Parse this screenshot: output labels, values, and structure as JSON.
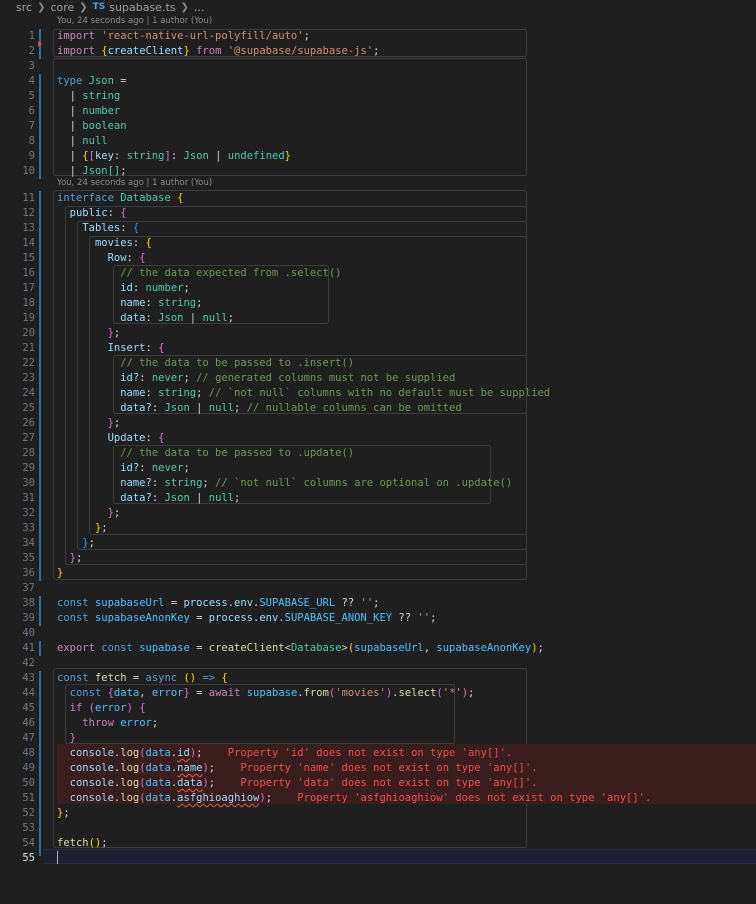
{
  "breadcrumb": {
    "items": [
      "src",
      "core"
    ],
    "file_icon": "TS",
    "file": "supabase.ts",
    "ellipsis": "..."
  },
  "codelens": {
    "top": "You, 24 seconds ago | 1 author (You)",
    "interface": "You, 24 seconds ago | 1 author (You)"
  },
  "line_numbers": [
    "1",
    "2",
    "3",
    "4",
    "5",
    "6",
    "7",
    "8",
    "9",
    "10",
    "11",
    "12",
    "13",
    "14",
    "15",
    "16",
    "17",
    "18",
    "19",
    "20",
    "21",
    "22",
    "23",
    "24",
    "25",
    "26",
    "27",
    "28",
    "29",
    "30",
    "31",
    "32",
    "33",
    "34",
    "35",
    "36",
    "37",
    "38",
    "39",
    "40",
    "41",
    "42",
    "43",
    "44",
    "45",
    "46",
    "47",
    "48",
    "49",
    "50",
    "51",
    "52",
    "53",
    "54",
    "55"
  ],
  "code": {
    "l1": {
      "kw": "import",
      "str": "'react-native-url-polyfill/auto'",
      "end": ";"
    },
    "l2": {
      "kw": "import",
      "name": "createClient",
      "from": "from",
      "str": "'@supabase/supabase-js'",
      "end": ";"
    },
    "l4": {
      "kw": "type",
      "name": "Json",
      "eq": " ="
    },
    "l5": {
      "t": "string"
    },
    "l6": {
      "t": "number"
    },
    "l7": {
      "t": "boolean"
    },
    "l8": {
      "t": "null"
    },
    "l9": {
      "key": "key",
      "t1": "string",
      "t2": "Json",
      "t3": "undefined"
    },
    "l10": {
      "t": "Json[]"
    },
    "l11": {
      "kw": "interface",
      "name": "Database"
    },
    "l12": {
      "name": "public"
    },
    "l13": {
      "name": "Tables"
    },
    "l14": {
      "name": "movies"
    },
    "l15": {
      "name": "Row"
    },
    "l16": {
      "comment": "// the data expected from .select()"
    },
    "l17": {
      "prop": "id",
      "t": "number"
    },
    "l18": {
      "prop": "name",
      "t": "string"
    },
    "l19": {
      "prop": "data",
      "t1": "Json",
      "t2": "null"
    },
    "l21": {
      "name": "Insert"
    },
    "l22": {
      "comment": "// the data to be passed to .insert()"
    },
    "l23": {
      "prop": "id?",
      "t": "never",
      "comment": "// generated columns must not be supplied"
    },
    "l24": {
      "prop": "name",
      "t": "string",
      "comment": "// `not null` columns with no default must be supplied"
    },
    "l25": {
      "prop": "data?",
      "t1": "Json",
      "t2": "null",
      "comment": "// nullable columns can be omitted"
    },
    "l27": {
      "name": "Update"
    },
    "l28": {
      "comment": "// the data to be passed to .update()"
    },
    "l29": {
      "prop": "id?",
      "t": "never"
    },
    "l30": {
      "prop": "name?",
      "t": "string",
      "comment": "// `not null` columns are optional on .update()"
    },
    "l31": {
      "prop": "data?",
      "t1": "Json",
      "t2": "null"
    },
    "l38": {
      "kw": "const",
      "name": "supabaseUrl",
      "obj": "process",
      "env": "env",
      "cst": "SUPABASE_URL",
      "op": "??",
      "str": "''"
    },
    "l39": {
      "kw": "const",
      "name": "supabaseAnonKey",
      "obj": "process",
      "env": "env",
      "cst": "SUPABASE_ANON_KEY",
      "op": "??",
      "str": "''"
    },
    "l41": {
      "kw1": "export",
      "kw2": "const",
      "name": "supabase",
      "fn": "createClient",
      "type": "Database",
      "a1": "supabaseUrl",
      "a2": "supabaseAnonKey"
    },
    "l43": {
      "kw": "const",
      "name": "fetch",
      "kw2": "async"
    },
    "l44": {
      "kw": "const",
      "d": "data",
      "e": "error",
      "kw2": "await",
      "obj": "supabase",
      "fn1": "from",
      "str1": "'movies'",
      "fn2": "select",
      "str2": "'*'"
    },
    "l45": {
      "kw": "if",
      "e": "error"
    },
    "l46": {
      "kw": "throw",
      "e": "error"
    },
    "l48": {
      "obj": "console",
      "fn": "log",
      "d": "data",
      "prop": "id",
      "msg": "Property 'id' does not exist on type 'any[]'."
    },
    "l49": {
      "obj": "console",
      "fn": "log",
      "d": "data",
      "prop": "name",
      "msg": "Property 'name' does not exist on type 'any[]'."
    },
    "l50": {
      "obj": "console",
      "fn": "log",
      "d": "data",
      "prop": "data",
      "msg": "Property 'data' does not exist on type 'any[]'."
    },
    "l51": {
      "obj": "console",
      "fn": "log",
      "d": "data",
      "prop": "asfghioaghiow",
      "msg": "Property 'asfghioaghiow' does not exist on type 'any[]'."
    },
    "l54": {
      "fn": "fetch"
    }
  },
  "colors": {
    "background": "#1f1f1f",
    "error": "#f14c4c",
    "error_bg": "#3a1d1d",
    "comment": "#6a9955",
    "string": "#ce9178",
    "type": "#4ec9b0"
  }
}
